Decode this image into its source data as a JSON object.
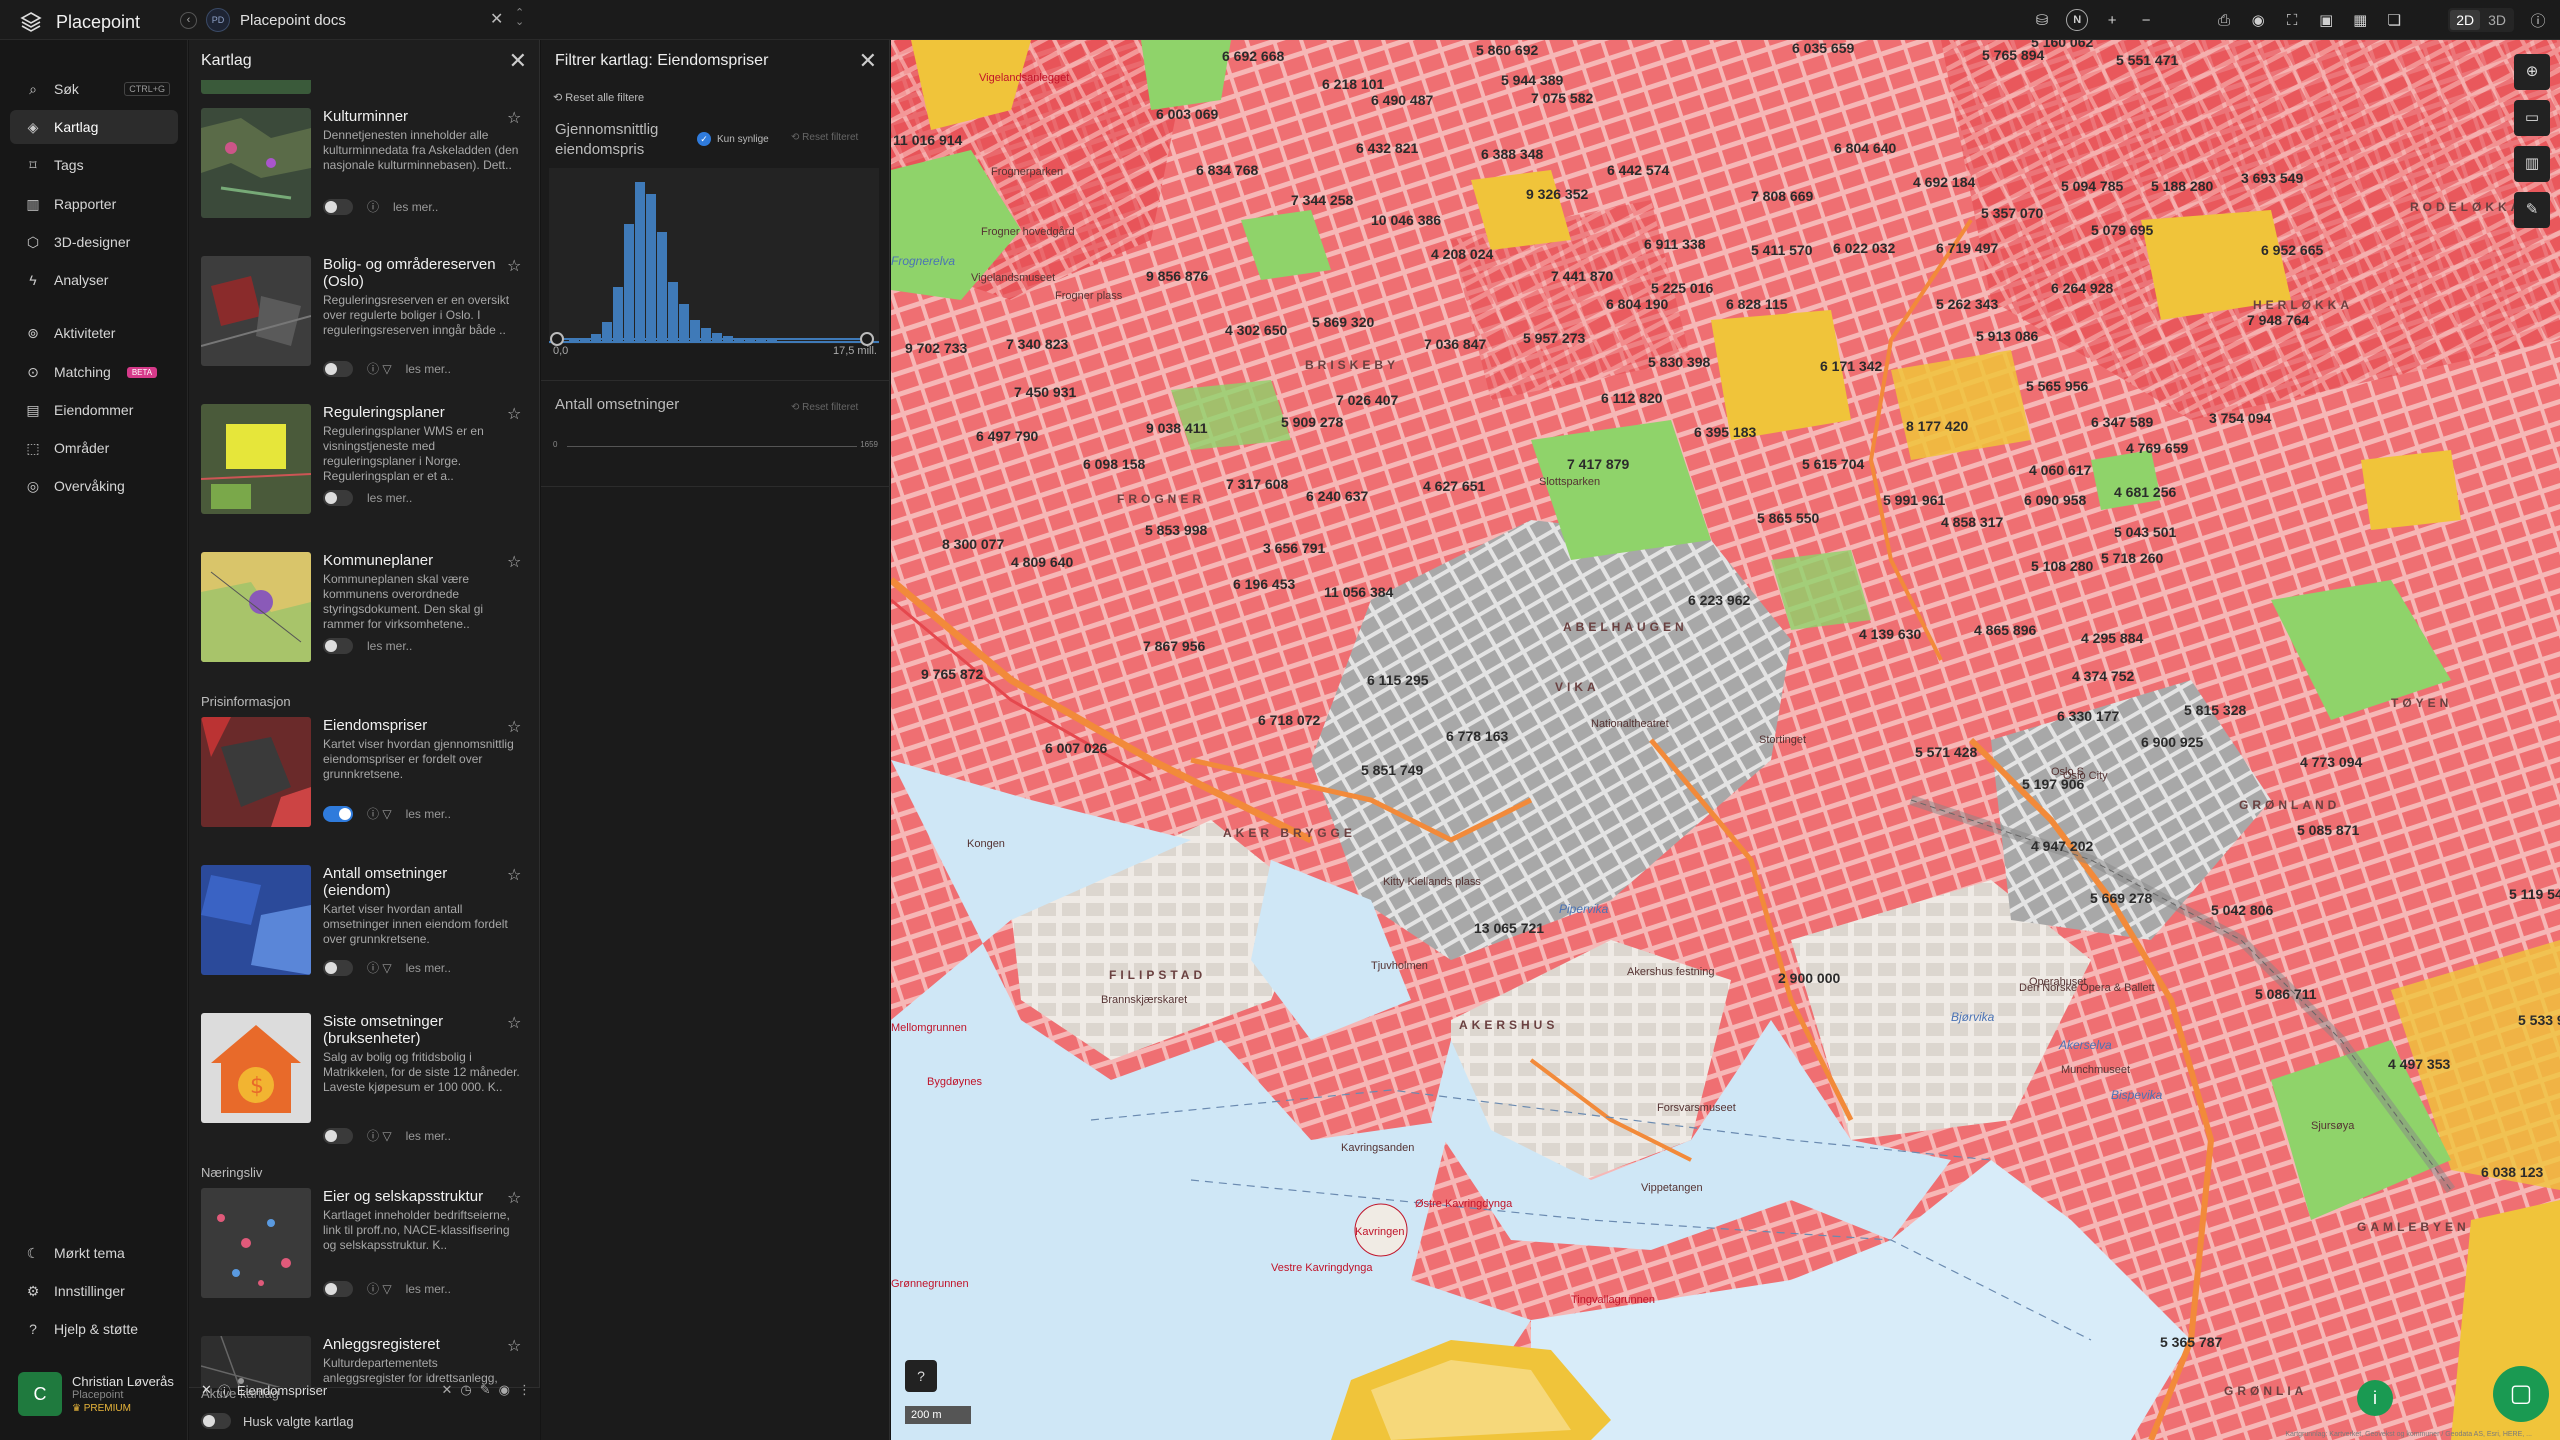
{
  "app": {
    "name": "Placepoint"
  },
  "workspace": {
    "badge": "PD",
    "title": "Placepoint docs"
  },
  "toolbar": {
    "north": "N",
    "mode_2d": "2D",
    "mode_3d": "3D"
  },
  "nav": {
    "items": [
      {
        "label": "Søk",
        "shortcut": "CTRL+G"
      },
      {
        "label": "Kartlag"
      },
      {
        "label": "Tags"
      },
      {
        "label": "Rapporter"
      },
      {
        "label": "3D-designer"
      },
      {
        "label": "Analyser"
      },
      {
        "label": "Aktiviteter"
      },
      {
        "label": "Matching",
        "badge": "BETA"
      },
      {
        "label": "Eiendommer"
      },
      {
        "label": "Områder"
      },
      {
        "label": "Overvåking"
      }
    ],
    "bottom": [
      {
        "label": "Mørkt tema"
      },
      {
        "label": "Innstillinger"
      },
      {
        "label": "Hjelp & støtte"
      }
    ],
    "user": {
      "initial": "C",
      "name": "Christian Løverås",
      "org": "Placepoint",
      "tier": "PREMIUM"
    }
  },
  "layers": {
    "title": "Kartlag",
    "cards": [
      {
        "title": "Kulturminner",
        "desc": "Dennetjenesten inneholder alle kulturminnedata fra Askeladden (den nasjonale kulturminnebasen). Dett..",
        "more": "les mer.."
      },
      {
        "title": "Bolig- og områdereserven (Oslo)",
        "desc": "Reguleringsreserven er en oversikt over regulerte boliger i Oslo. I reguleringsreserven inngår både ..",
        "more": "les mer.."
      },
      {
        "title": "Reguleringsplaner",
        "desc": "Reguleringsplaner WMS er en visningstjeneste med reguleringsplaner i Norge. Reguleringsplan er et a..",
        "more": "les mer.."
      },
      {
        "title": "Kommuneplaner",
        "desc": "Kommuneplanen skal være kommunens overordnede styringsdokument. Den skal gi rammer for virksomhetene..",
        "more": "les mer.."
      }
    ],
    "section_pris": "Prisinformasjon",
    "cards_pris": [
      {
        "title": "Eiendomspriser",
        "desc": "Kartet viser hvordan gjennomsnittlig eiendomspriser er fordelt over grunnkretsene.",
        "more": "les mer.."
      },
      {
        "title": "Antall omsetninger (eiendom)",
        "desc": "Kartet viser hvordan antall omsetninger innen eiendom fordelt over grunnkretsene.",
        "more": "les mer.."
      },
      {
        "title": "Siste omsetninger (bruksenheter)",
        "desc": "Salg av bolig og fritidsbolig i Matrikkelen, for de siste 12 måneder. Laveste kjøpesum er 100 000. K..",
        "more": "les mer.."
      }
    ],
    "section_naering": "Næringsliv",
    "cards_naering": [
      {
        "title": "Eier og selskapsstruktur",
        "desc": "Kartlaget inneholder bedriftseierne, link til proff.no, NACE-klassifisering og selskapsstruktur. K..",
        "more": "les mer.."
      },
      {
        "title": "Anleggsregisteret",
        "desc": "Kulturdepartementets anleggsregister for idrettsanlegg, kulturbygg, friluftslivsanlegg og tilskudd.",
        "more": ""
      }
    ],
    "active_title": "Aktive kartlag",
    "active_layer": "Eiendomspriser",
    "remember": "Husk valgte kartlag"
  },
  "filter": {
    "title": "Filtrer kartlag: Eiendomspriser",
    "reset_all": "Reset alle filtere",
    "f1": {
      "label": "Gjennomsnittlig eiendomspris",
      "only_visible": "Kun synlige",
      "reset": "Reset filteret",
      "min": "0,0",
      "max": "17,5 mill."
    },
    "f2": {
      "label": "Antall omsetninger",
      "reset": "Reset filteret",
      "min": "0",
      "max": "1659"
    }
  },
  "map": {
    "prices": [
      {
        "v": "6 692 668"
      },
      {
        "v": "6 218 101"
      },
      {
        "v": "5 860 692"
      },
      {
        "v": "5 944 389"
      },
      {
        "v": "5 765 894"
      },
      {
        "v": "5 551 471"
      },
      {
        "v": "6 035 659"
      },
      {
        "v": "5 160 062"
      },
      {
        "v": "11 016 914"
      },
      {
        "v": "6 003 069"
      },
      {
        "v": "6 490 487"
      },
      {
        "v": "7 075 582"
      },
      {
        "v": "6 432 821"
      },
      {
        "v": "6 388 348"
      },
      {
        "v": "6 804 640"
      },
      {
        "v": "6 834 768"
      },
      {
        "v": "6 442 574"
      },
      {
        "v": "4 692 184"
      },
      {
        "v": "7 344 258"
      },
      {
        "v": "10 046 386"
      },
      {
        "v": "9 326 352"
      },
      {
        "v": "7 808 669"
      },
      {
        "v": "5 094 785"
      },
      {
        "v": "5 188 280"
      },
      {
        "v": "3 693 549"
      },
      {
        "v": "5 357 070"
      },
      {
        "v": "5 079 695"
      },
      {
        "v": "4 208 024"
      },
      {
        "v": "6 911 338"
      },
      {
        "v": "5 411 570"
      },
      {
        "v": "6 022 032"
      },
      {
        "v": "6 719 497"
      },
      {
        "v": "6 952 665"
      },
      {
        "v": "9 856 876"
      },
      {
        "v": "7 441 870"
      },
      {
        "v": "5 225 016"
      },
      {
        "v": "6 804 190"
      },
      {
        "v": "6 828 115"
      },
      {
        "v": "6 264 928"
      },
      {
        "v": "5 262 343"
      },
      {
        "v": "7 948 764"
      },
      {
        "v": "4 302 650"
      },
      {
        "v": "5 869 320"
      },
      {
        "v": "5 957 273"
      },
      {
        "v": "5 913 086"
      },
      {
        "v": "9 702 733"
      },
      {
        "v": "7 340 823"
      },
      {
        "v": "7 036 847"
      },
      {
        "v": "5 830 398"
      },
      {
        "v": "6 171 342"
      },
      {
        "v": "5 565 956"
      },
      {
        "v": "7 450 931"
      },
      {
        "v": "7 026 407"
      },
      {
        "v": "6 112 820"
      },
      {
        "v": "6 497 790"
      },
      {
        "v": "9 038 411"
      },
      {
        "v": "5 909 278"
      },
      {
        "v": "6 395 183"
      },
      {
        "v": "8 177 420"
      },
      {
        "v": "6 347 589"
      },
      {
        "v": "3 754 094"
      },
      {
        "v": "6 098 158"
      },
      {
        "v": "4 769 659"
      },
      {
        "v": "7 417 879"
      },
      {
        "v": "5 615 704"
      },
      {
        "v": "4 060 617"
      },
      {
        "v": "7 317 608"
      },
      {
        "v": "4 627 651"
      },
      {
        "v": "6 240 637"
      },
      {
        "v": "5 991 961"
      },
      {
        "v": "6 090 958"
      },
      {
        "v": "4 681 256"
      },
      {
        "v": "5 853 998"
      },
      {
        "v": "5 865 550"
      },
      {
        "v": "4 858 317"
      },
      {
        "v": "5 043 501"
      },
      {
        "v": "8 300 077"
      },
      {
        "v": "3 656 791"
      },
      {
        "v": "5 718 260"
      },
      {
        "v": "4 809 640"
      },
      {
        "v": "5 108 280"
      },
      {
        "v": "6 196 453"
      },
      {
        "v": "11 056 384"
      },
      {
        "v": "6 223 962"
      },
      {
        "v": "4 865 896"
      },
      {
        "v": "4 295 884"
      },
      {
        "v": "7 867 956"
      },
      {
        "v": "4 139 630"
      },
      {
        "v": "9 765 872"
      },
      {
        "v": "6 115 295"
      },
      {
        "v": "4 374 752"
      },
      {
        "v": "5 815 328"
      },
      {
        "v": "6 718 072"
      },
      {
        "v": "6 778 163"
      },
      {
        "v": "6 330 177"
      },
      {
        "v": "6 007 026"
      },
      {
        "v": "5 851 749"
      },
      {
        "v": "5 571 428"
      },
      {
        "v": "6 900 925"
      },
      {
        "v": "4 773 094"
      },
      {
        "v": "5 197 906"
      },
      {
        "v": "5 085 871"
      },
      {
        "v": "4 947 202"
      },
      {
        "v": "5 669 278"
      },
      {
        "v": "5 042 806"
      },
      {
        "v": "5 119 549"
      },
      {
        "v": "13 065 721"
      },
      {
        "v": "2 900 000"
      },
      {
        "v": "5 086 711"
      },
      {
        "v": "5 533 9"
      },
      {
        "v": "4 497 353"
      },
      {
        "v": "6 038 123"
      },
      {
        "v": "5 365 787"
      }
    ],
    "districts": [
      {
        "v": "FROGNER"
      },
      {
        "v": "BRISKEBY"
      },
      {
        "v": "ABELHAUGEN"
      },
      {
        "v": "AKER BRYGGE"
      },
      {
        "v": "FILIPSTAD"
      },
      {
        "v": "AKERSHUS"
      },
      {
        "v": "GRØNLAND"
      },
      {
        "v": "TØYEN"
      },
      {
        "v": "GAMLEBYEN"
      },
      {
        "v": "RODELØKKA"
      },
      {
        "v": "GRØNLIA"
      },
      {
        "v": "VIKA"
      },
      {
        "v": "HERLØKKA"
      }
    ],
    "places": [
      {
        "v": "Frognerparken"
      },
      {
        "v": "Frogner hovedgård"
      },
      {
        "v": "Vigelandsmuseet"
      },
      {
        "v": "Frogner plass"
      },
      {
        "v": "Vigelandsanlegget"
      },
      {
        "v": "Slottsparken"
      },
      {
        "v": "Nationaltheatret"
      },
      {
        "v": "Oslo S"
      },
      {
        "v": "Oslo City"
      },
      {
        "v": "Operahuset"
      },
      {
        "v": "Akershus festning"
      },
      {
        "v": "Kavringen"
      },
      {
        "v": "Østre Kavringdynga"
      },
      {
        "v": "Vestre Kavringdynga"
      },
      {
        "v": "Tingvallagrunnen"
      },
      {
        "v": "Bygdøynes"
      },
      {
        "v": "Kongen"
      },
      {
        "v": "Tjuvholmen"
      },
      {
        "v": "Kavringsanden"
      },
      {
        "v": "Vippetangen"
      },
      {
        "v": "Forsvarsmuseet"
      },
      {
        "v": "Stortinget"
      },
      {
        "v": "Den Norske Opera & Ballett"
      },
      {
        "v": "Munchmuseet"
      },
      {
        "v": "Kitty Kiellands plass"
      },
      {
        "v": "Brannskjærskaret"
      },
      {
        "v": "Grønnegrunnen"
      },
      {
        "v": "Mellomgrunnen"
      },
      {
        "v": "Sjursøya"
      }
    ],
    "water": [
      {
        "v": "Pipervika"
      },
      {
        "v": "Akerselva"
      },
      {
        "v": "Bjørvika"
      },
      {
        "v": "Bispevika"
      },
      {
        "v": "Frognerelva"
      }
    ],
    "scale": "200 m",
    "attribution": "Kartgrunnlag: Kartverket, Geovekst og kommuner / Geodata AS, Esri, HERE, ..."
  }
}
